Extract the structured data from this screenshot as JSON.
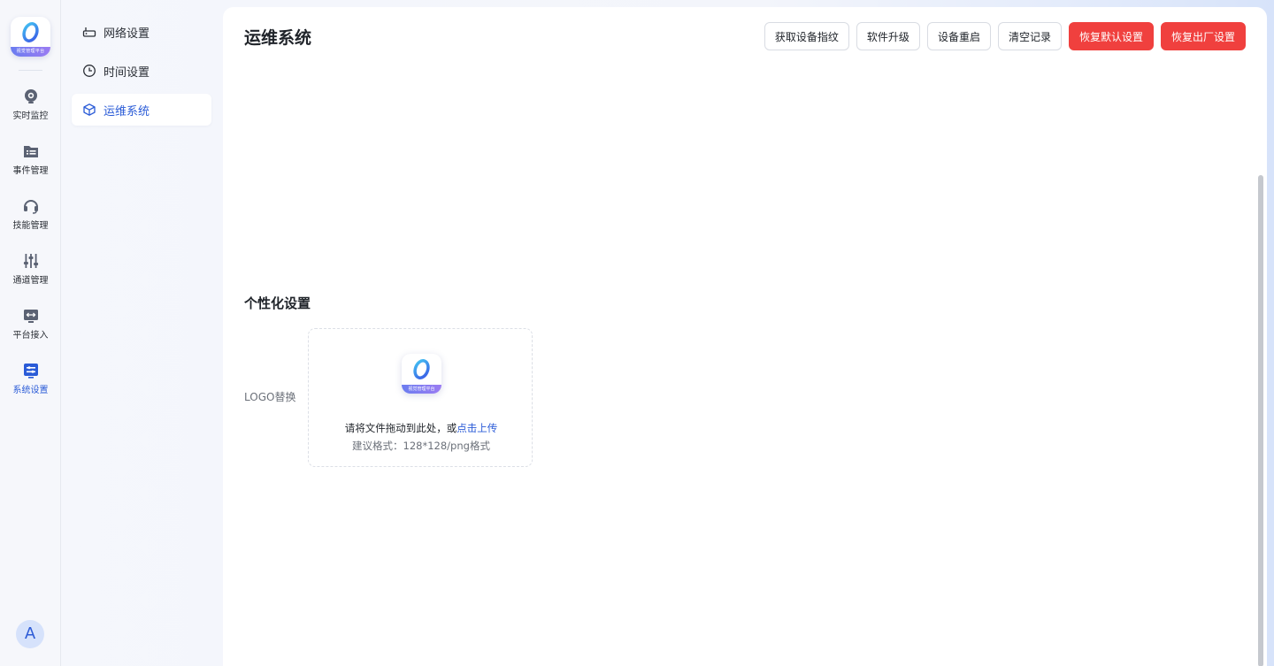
{
  "app": {
    "logo_caption": "视觉管理平台",
    "avatar_initial": "A"
  },
  "rail": {
    "items": [
      {
        "label": "实时监控",
        "icon": "camera-icon"
      },
      {
        "label": "事件管理",
        "icon": "folder-list-icon"
      },
      {
        "label": "技能管理",
        "icon": "headset-icon"
      },
      {
        "label": "通道管理",
        "icon": "sliders-icon"
      },
      {
        "label": "平台接入",
        "icon": "monitor-arrows-icon"
      },
      {
        "label": "系统设置",
        "icon": "settings-panel-icon",
        "active": true
      }
    ]
  },
  "submenu": {
    "items": [
      {
        "label": "网络设置",
        "icon": "router-icon"
      },
      {
        "label": "时间设置",
        "icon": "clock-icon"
      },
      {
        "label": "运维系统",
        "icon": "cube-icon",
        "active": true
      }
    ]
  },
  "main": {
    "title": "运维系统",
    "actions": [
      {
        "label": "获取设备指纹",
        "style": "default"
      },
      {
        "label": "软件升级",
        "style": "default"
      },
      {
        "label": "设备重启",
        "style": "default"
      },
      {
        "label": "清空记录",
        "style": "default"
      },
      {
        "label": "恢复默认设置",
        "style": "danger"
      },
      {
        "label": "恢复出厂设置",
        "style": "danger"
      }
    ],
    "personalization": {
      "title": "个性化设置",
      "logo_label": "LOGO替换",
      "upload_hint": "请将文件拖动到此处，或",
      "upload_link": "点击上传",
      "upload_format": "建议格式：128*128/png格式",
      "preview_caption": "视觉管理平台"
    }
  },
  "colors": {
    "accent": "#2a5bd7",
    "danger": "#f0403e",
    "text_primary": "#1f2329",
    "text_secondary": "#6b7079"
  }
}
